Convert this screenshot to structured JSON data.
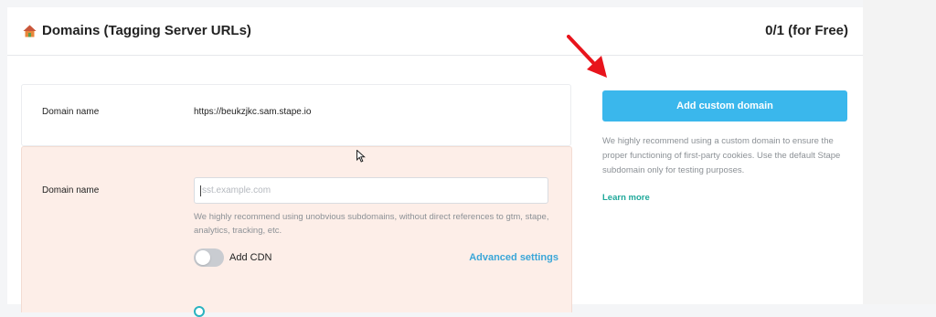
{
  "header": {
    "title": "Domains (Tagging Server URLs)",
    "quota": "0/1 (for Free)",
    "icon": "house-icon"
  },
  "current_domain": {
    "label": "Domain name",
    "value": "https://beukzjkc.sam.stape.io"
  },
  "custom_domain_form": {
    "label": "Domain name",
    "placeholder": "sst.example.com",
    "value": "",
    "hint": "We highly recommend using unobvious subdomains, without direct references to gtm, stape, analytics, tracking, etc.",
    "cdn_label": "Add CDN",
    "cdn_enabled": false,
    "advanced_settings": "Advanced settings"
  },
  "sidebar": {
    "add_button": "Add custom domain",
    "recommendation": "We highly recommend using a custom domain to ensure the proper functioning of first-party cookies. Use the default Stape subdomain only for testing purposes.",
    "learn_more": "Learn more"
  },
  "colors": {
    "accent": "#3ab7ec",
    "link": "#3aa6d8",
    "learn_more": "#1fa89a",
    "form_background": "#fdeee8",
    "annotation_arrow": "#e8141c"
  }
}
